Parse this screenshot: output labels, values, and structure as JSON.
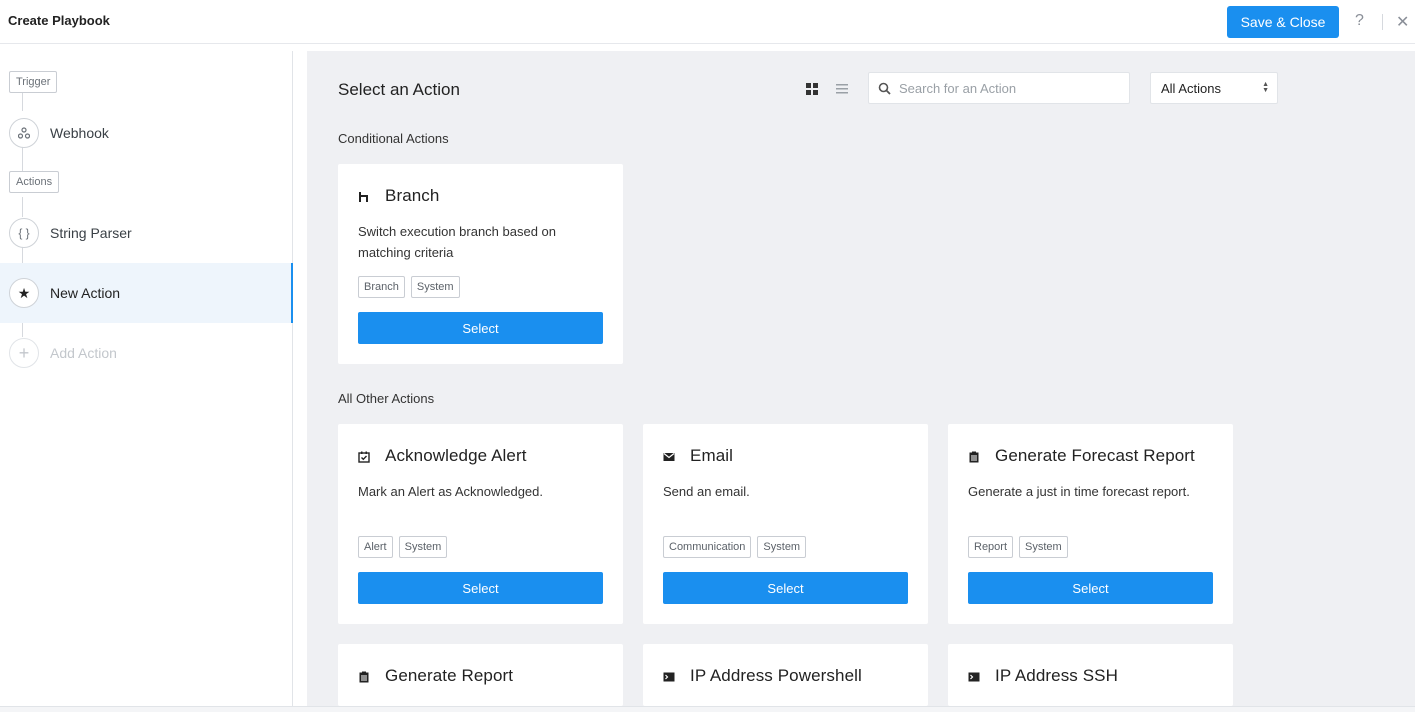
{
  "header": {
    "title": "Create Playbook",
    "save_label": "Save & Close",
    "help_label": "?",
    "close_label": "✕"
  },
  "sidebar": {
    "trigger_label": "Trigger",
    "actions_label": "Actions",
    "steps": [
      {
        "label": "Webhook",
        "icon": "webhook-icon"
      },
      {
        "label": "String Parser",
        "icon": "braces-icon",
        "glyph": "{ }"
      },
      {
        "label": "New Action",
        "icon": "star-icon",
        "glyph": "★"
      },
      {
        "label": "Add Action",
        "icon": "plus-icon",
        "glyph": "+"
      }
    ]
  },
  "main": {
    "title": "Select an Action",
    "search_placeholder": "Search for an Action",
    "filter_value": "All Actions",
    "conditional_label": "Conditional Actions",
    "other_label": "All Other Actions",
    "select_label": "Select",
    "conditional_cards": [
      {
        "title": "Branch",
        "desc": "Switch execution branch based on matching criteria",
        "tags": [
          "Branch",
          "System"
        ],
        "icon": "branch-icon"
      }
    ],
    "other_cards": [
      {
        "title": "Acknowledge Alert",
        "desc": "Mark an Alert as Acknowledged.",
        "tags": [
          "Alert",
          "System"
        ],
        "icon": "check-calendar-icon"
      },
      {
        "title": "Email",
        "desc": "Send an email.",
        "tags": [
          "Communication",
          "System"
        ],
        "icon": "envelope-icon"
      },
      {
        "title": "Generate Forecast Report",
        "desc": "Generate a just in time forecast report.",
        "tags": [
          "Report",
          "System"
        ],
        "icon": "clipboard-icon"
      },
      {
        "title": "Generate Report",
        "icon": "clipboard-icon"
      },
      {
        "title": "IP Address Powershell",
        "icon": "terminal-icon"
      },
      {
        "title": "IP Address SSH",
        "icon": "terminal-icon"
      }
    ]
  },
  "colors": {
    "accent": "#1a8fef",
    "main_bg": "#eff0f3",
    "active_row_bg": "#eef5fc"
  }
}
